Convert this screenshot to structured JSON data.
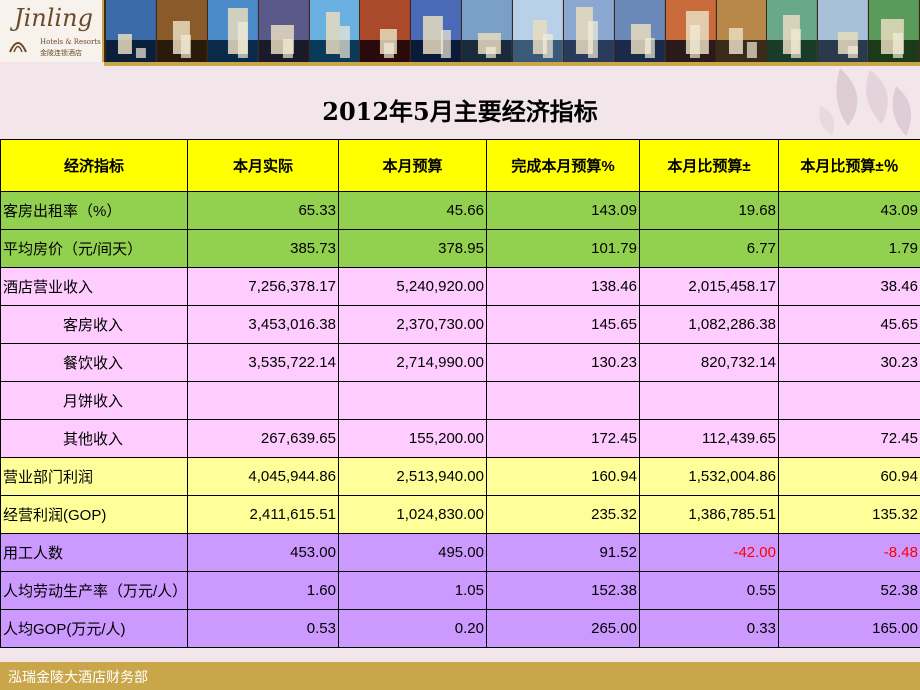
{
  "logo": {
    "brand": "Jinling",
    "sub": "Hotels & Resorts",
    "cn": "金陵连锁酒店"
  },
  "header_images": [
    "hotel-photo-1-icon",
    "hotel-photo-2-icon",
    "hotel-photo-3-icon",
    "hotel-photo-4-icon",
    "hotel-photo-5-icon",
    "hotel-photo-6-icon",
    "hotel-photo-7-icon",
    "hotel-photo-8-icon",
    "hotel-photo-9-icon",
    "hotel-photo-10-icon",
    "hotel-photo-11-icon",
    "hotel-photo-12-icon",
    "hotel-photo-13-icon",
    "hotel-photo-14-icon",
    "hotel-photo-15-icon",
    "hotel-photo-16-icon"
  ],
  "title": "2012年5月主要经济指标",
  "table": {
    "headers": [
      "经济指标",
      "本月实际",
      "本月预算",
      "完成本月预算%",
      "本月比预算±",
      "本月比预算±％"
    ],
    "rows": [
      {
        "label": "客房出租率（%）",
        "values": [
          "65.33",
          "45.66",
          "143.09",
          "19.68",
          "43.09"
        ]
      },
      {
        "label": "平均房价（元/间天）",
        "values": [
          "385.73",
          "378.95",
          "101.79",
          "6.77",
          "1.79"
        ]
      },
      {
        "label": "酒店营业收入",
        "values": [
          "7,256,378.17",
          "5,240,920.00",
          "138.46",
          "2,015,458.17",
          "38.46"
        ]
      },
      {
        "label": "客房收入",
        "values": [
          "3,453,016.38",
          "2,370,730.00",
          "145.65",
          "1,082,286.38",
          "45.65"
        ]
      },
      {
        "label": "餐饮收入",
        "values": [
          "3,535,722.14",
          "2,714,990.00",
          "130.23",
          "820,732.14",
          "30.23"
        ]
      },
      {
        "label": "月饼收入",
        "values": [
          "",
          "",
          "",
          "",
          ""
        ]
      },
      {
        "label": "其他收入",
        "values": [
          "267,639.65",
          "155,200.00",
          "172.45",
          "112,439.65",
          "72.45"
        ]
      },
      {
        "label": "营业部门利润",
        "values": [
          "4,045,944.86",
          "2,513,940.00",
          "160.94",
          "1,532,004.86",
          "60.94"
        ]
      },
      {
        "label": "经营利润(GOP)",
        "values": [
          "2,411,615.51",
          "1,024,830.00",
          "235.32",
          "1,386,785.51",
          "135.32"
        ]
      },
      {
        "label": "用工人数",
        "values": [
          "453.00",
          "495.00",
          "91.52",
          "-42.00",
          "-8.48"
        ]
      },
      {
        "label": "人均劳动生产率（万元/人）",
        "values": [
          "1.60",
          "1.05",
          "152.38",
          "0.55",
          "52.38"
        ]
      },
      {
        "label": "人均GOP(万元/人)",
        "values": [
          "0.53",
          "0.20",
          "265.00",
          "0.33",
          "165.00"
        ]
      }
    ]
  },
  "colors": {
    "header_bg": "#ffff00",
    "green_rows": "#92d050",
    "pink_rows": "#ffccff",
    "yellow_rows": "#ffff99",
    "purple_rows": "#cc99ff",
    "negative_text": "#ff0000",
    "gold_accent": "#c9a64a"
  },
  "footer": "泓瑞金陵大酒店财务部"
}
